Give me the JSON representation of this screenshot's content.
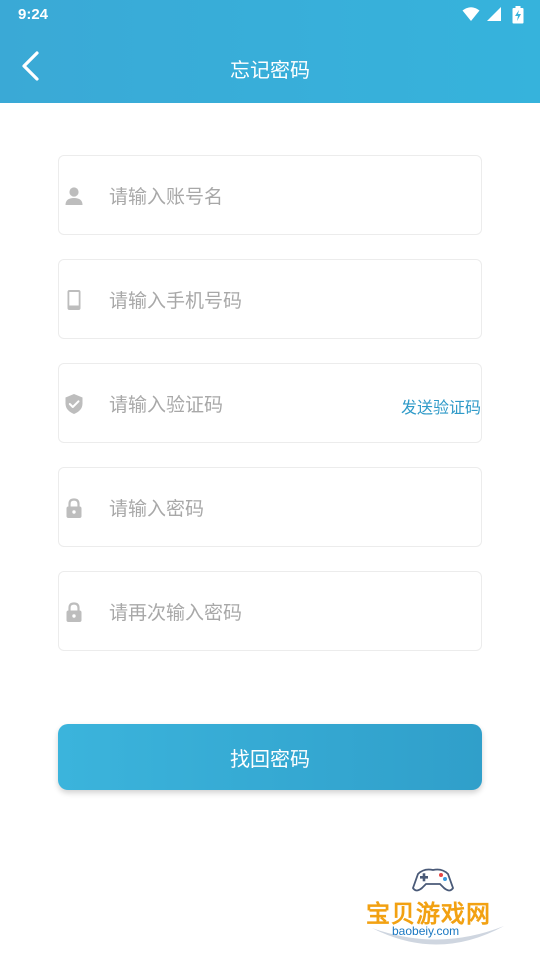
{
  "status_bar": {
    "time": "9:24"
  },
  "header": {
    "title": "忘记密码"
  },
  "form": {
    "username_placeholder": "请输入账号名",
    "phone_placeholder": "请输入手机号码",
    "code_placeholder": "请输入验证码",
    "send_code_label": "发送验证码",
    "password_placeholder": "请输入密码",
    "confirm_password_placeholder": "请再次输入密码"
  },
  "submit_label": "找回密码",
  "watermark": {
    "name": "宝贝游戏网",
    "url": "baobeiy.com"
  },
  "colors": {
    "header": "#36b3dc",
    "accent": "#2f9ac8",
    "icon": "#bdbdbd",
    "button": "#309fca"
  }
}
